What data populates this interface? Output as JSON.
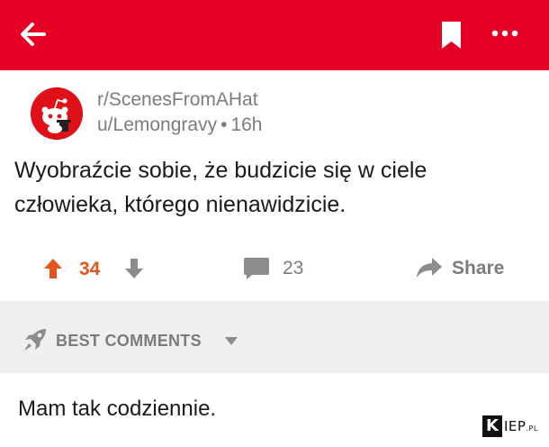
{
  "colors": {
    "header_bg": "#e60023",
    "upvote_accent": "#e8531d",
    "muted_text": "#7c7c7c",
    "body_text": "#1a1a1a",
    "band_bg": "#edeff1"
  },
  "header": {
    "back_icon": "back-arrow-icon",
    "bookmark_icon": "bookmark-icon",
    "more_icon": "more-options-icon"
  },
  "post": {
    "subreddit": "r/ScenesFromAHat",
    "author": "u/Lemongravy",
    "separator": "•",
    "age": "16h",
    "title": "Wyobraźcie sobie, że budzicie się w ciele człowieka, którego nienawidzicie.",
    "avatar_icon": "reddit-snoo-avatar"
  },
  "actions": {
    "score": "34",
    "comment_count": "23",
    "share_label": "Share"
  },
  "comments_section": {
    "sort_label": "BEST COMMENTS",
    "sort_icon": "rocket-icon"
  },
  "comments": [
    {
      "text": "Mam tak codziennie."
    }
  ],
  "watermark": {
    "k": "K",
    "rest": "IEP",
    "suffix": ".PL"
  }
}
